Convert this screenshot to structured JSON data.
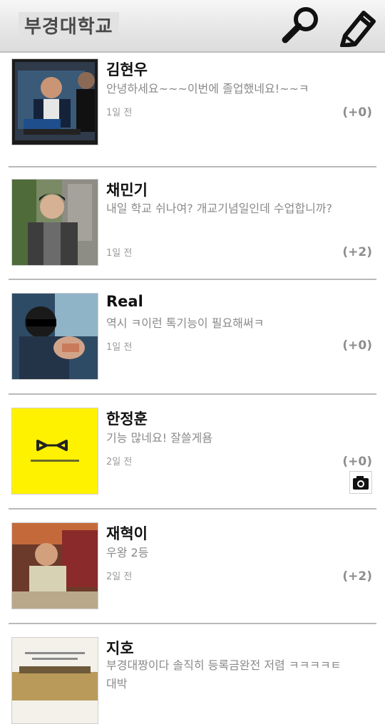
{
  "header": {
    "title": "부경대학교",
    "search_icon": "search-icon",
    "write_icon": "pencil-icon"
  },
  "posts": [
    {
      "name": "김현우",
      "message": "안녕하세요~~~이번에 졸업했네요!~~ㅋ",
      "time": "1일 전",
      "count": "(+0)",
      "thumbnail": "tv-screen-photo"
    },
    {
      "name": "채민기",
      "message": "내일 학교 쉬나여? 개교기념일인데 수업합니까?",
      "time": "1일 전",
      "count": "(+2)",
      "thumbnail": "outdoor-portrait-photo"
    },
    {
      "name": "Real",
      "message": "역시 ㅋ이런 톡기능이 필요해써ㅋ",
      "time": "1일 전",
      "count": "(+0)",
      "thumbnail": "sunglasses-photo"
    },
    {
      "name": "한정훈",
      "message": "기능 많네요! 잘쓸게욤",
      "time": "2일 전",
      "count": "(+0)",
      "thumbnail": "yellow-logo-image",
      "has_photo_icon": "camera-icon"
    },
    {
      "name": "재혁이",
      "message": "우왕 2등",
      "time": "2일 전",
      "count": "(+2)",
      "thumbnail": "restaurant-photo"
    },
    {
      "name": "지호",
      "message": "부경대짱이다 솔직히 등록금완전 저렴 ㅋㅋㅋㅋㅌ대박",
      "time": "",
      "count": "",
      "thumbnail": "campus-photo"
    }
  ],
  "colors": {
    "header_bg": "#e4e4e4",
    "divider": "#b9b9b9",
    "name_text": "#111111",
    "message_text": "#8a8a8a",
    "yellow_thumb": "#fff200"
  }
}
